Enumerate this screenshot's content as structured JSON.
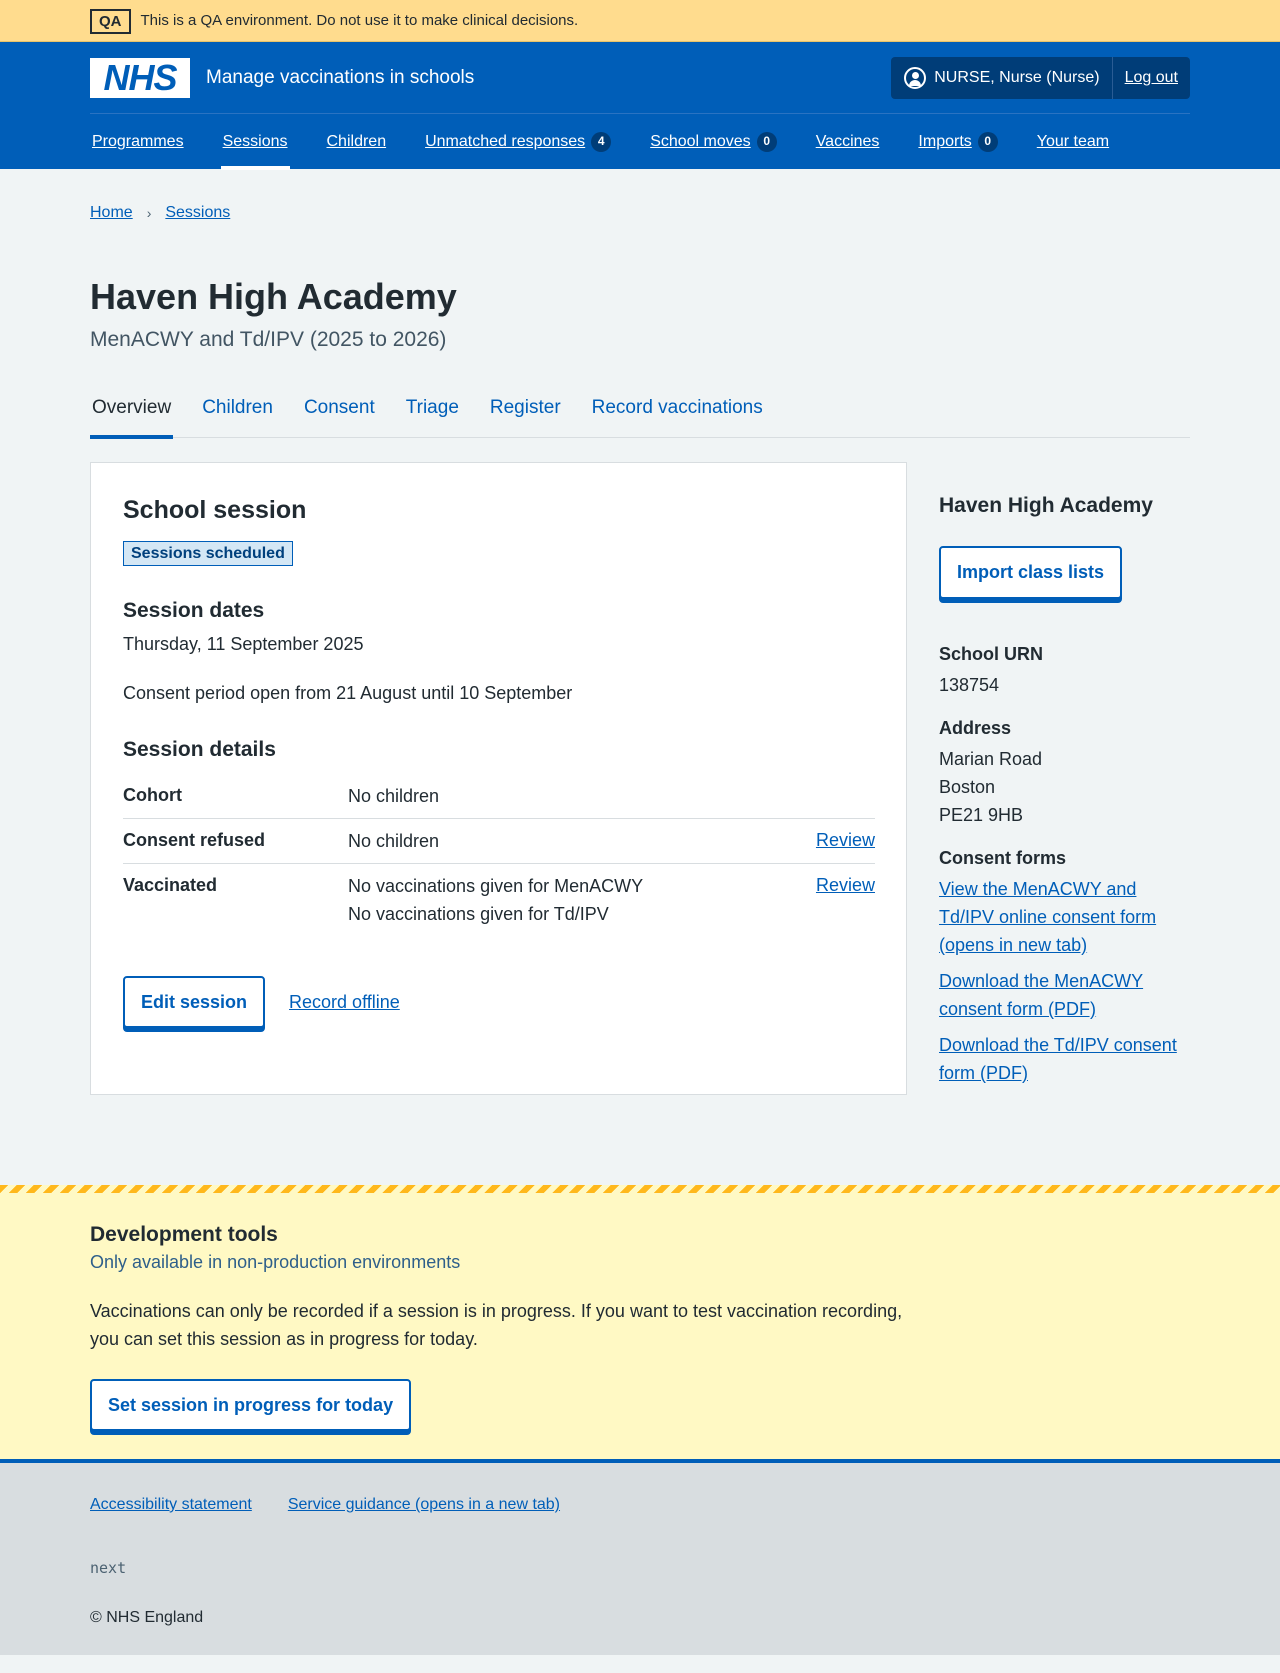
{
  "qa_banner": {
    "tag": "QA",
    "text": "This is a QA environment. Do not use it to make clinical decisions."
  },
  "header": {
    "logo": "NHS",
    "service_name": "Manage vaccinations in schools",
    "user": "NURSE, Nurse (Nurse)",
    "logout": "Log out"
  },
  "nav": [
    {
      "label": "Programmes"
    },
    {
      "label": "Sessions"
    },
    {
      "label": "Children"
    },
    {
      "label": "Unmatched responses",
      "count": "4"
    },
    {
      "label": "School moves",
      "count": "0"
    },
    {
      "label": "Vaccines"
    },
    {
      "label": "Imports",
      "count": "0"
    },
    {
      "label": "Your team"
    }
  ],
  "breadcrumb": [
    "Home",
    "Sessions"
  ],
  "page": {
    "title": "Haven High Academy",
    "caption": "MenACWY and Td/IPV (2025 to 2026)"
  },
  "tabs": [
    "Overview",
    "Children",
    "Consent",
    "Triage",
    "Register",
    "Record vaccinations"
  ],
  "card": {
    "title": "School session",
    "status": "Sessions scheduled",
    "dates_heading": "Session dates",
    "date": "Thursday, 11 September 2025",
    "consent_period": "Consent period open from 21 August until 10 September",
    "details_heading": "Session details",
    "rows": [
      {
        "key": "Cohort",
        "values": [
          "No children"
        ],
        "action": ""
      },
      {
        "key": "Consent refused",
        "values": [
          "No children"
        ],
        "action": "Review"
      },
      {
        "key": "Vaccinated",
        "values": [
          "No vaccinations given for MenACWY",
          "No vaccinations given for Td/IPV"
        ],
        "action": "Review"
      }
    ],
    "edit_button": "Edit session",
    "offline_link": "Record offline"
  },
  "sidebar": {
    "title": "Haven High Academy",
    "import_button": "Import class lists",
    "urn_label": "School URN",
    "urn": "138754",
    "address_label": "Address",
    "address": [
      "Marian Road",
      "Boston",
      "PE21 9HB"
    ],
    "consent_label": "Consent forms",
    "consent_links": [
      "View the MenACWY and Td/IPV online consent form (opens in new tab)",
      "Download the MenACWY consent form (PDF)",
      "Download the Td/IPV consent form (PDF)"
    ]
  },
  "dev_tools": {
    "title": "Development tools",
    "subtitle": "Only available in non-production environments",
    "body": "Vaccinations can only be recorded if a session is in progress. If you want to test vaccination recording, you can set this session as in progress for today.",
    "button": "Set session in progress for today"
  },
  "footer": {
    "links": [
      "Accessibility statement",
      "Service guidance (opens in a new tab)"
    ],
    "version": "next",
    "copyright": "© NHS England"
  }
}
